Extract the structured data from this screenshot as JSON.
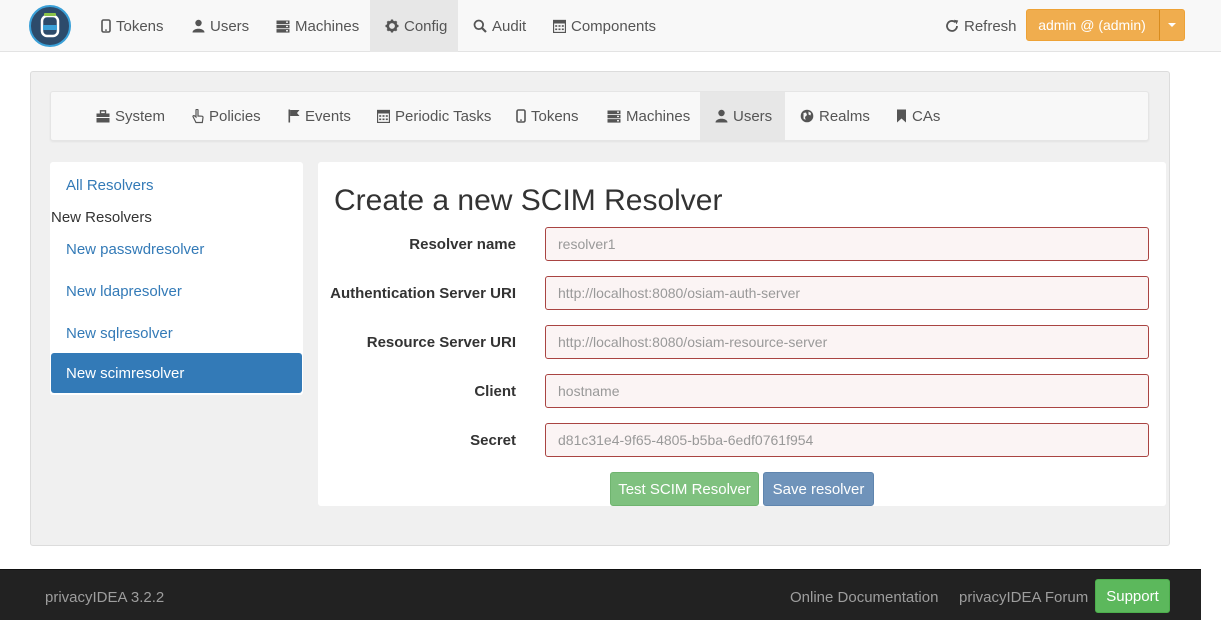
{
  "topnav": {
    "items": [
      {
        "label": "Tokens",
        "icon": "mobile-icon"
      },
      {
        "label": "Users",
        "icon": "user-icon"
      },
      {
        "label": "Machines",
        "icon": "server-icon"
      },
      {
        "label": "Config",
        "icon": "gear-icon",
        "active": true
      },
      {
        "label": "Audit",
        "icon": "search-icon"
      },
      {
        "label": "Components",
        "icon": "calendar-icon"
      }
    ],
    "refresh_label": "Refresh",
    "admin_label": "admin @ (admin)"
  },
  "subnav": {
    "items": [
      {
        "label": "System",
        "icon": "briefcase-icon"
      },
      {
        "label": "Policies",
        "icon": "hand-pointer-icon"
      },
      {
        "label": "Events",
        "icon": "flag-icon"
      },
      {
        "label": "Periodic Tasks",
        "icon": "calendar-icon"
      },
      {
        "label": "Tokens",
        "icon": "mobile-icon"
      },
      {
        "label": "Machines",
        "icon": "server-icon"
      },
      {
        "label": "Users",
        "icon": "user-icon",
        "active": true
      },
      {
        "label": "Realms",
        "icon": "globe-icon"
      },
      {
        "label": "CAs",
        "icon": "bookmark-icon"
      }
    ]
  },
  "sidebar": {
    "all_resolvers": "All Resolvers",
    "new_resolvers_heading": "New Resolvers",
    "items": [
      {
        "label": "New passwdresolver"
      },
      {
        "label": "New ldapresolver"
      },
      {
        "label": "New sqlresolver"
      },
      {
        "label": "New scimresolver",
        "active": true
      }
    ]
  },
  "form": {
    "title": "Create a new SCIM Resolver",
    "fields": [
      {
        "label": "Resolver name",
        "placeholder": "resolver1",
        "value": ""
      },
      {
        "label": "Authentication Server URI",
        "placeholder": "http://localhost:8080/osiam-auth-server",
        "value": ""
      },
      {
        "label": "Resource Server URI",
        "placeholder": "http://localhost:8080/osiam-resource-server",
        "value": ""
      },
      {
        "label": "Client",
        "placeholder": "hostname",
        "value": ""
      },
      {
        "label": "Secret",
        "placeholder": "d81c31e4-9f65-4805-b5ba-6edf0761f954",
        "value": ""
      }
    ],
    "test_button": "Test SCIM Resolver",
    "save_button": "Save resolver"
  },
  "footer": {
    "version": "privacyIDEA 3.2.2",
    "documentation": "Online Documentation",
    "forum": "privacyIDEA Forum",
    "support": "Support"
  },
  "colors": {
    "primary": "#337ab7",
    "warning": "#f0ad4e",
    "success": "#5cb85c",
    "error_border": "#a94442"
  }
}
